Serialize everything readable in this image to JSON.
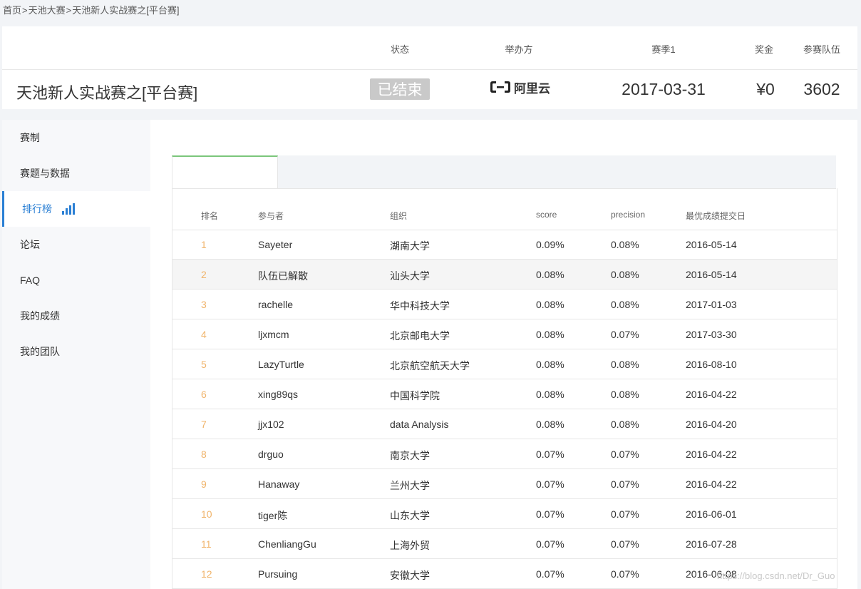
{
  "breadcrumb": [
    "首页",
    "天池大赛",
    "天池新人实战赛之[平台赛]"
  ],
  "breadcrumb_sep": ">",
  "header": {
    "labels": {
      "status": "状态",
      "organizer": "举办方",
      "season": "赛季1",
      "prize": "奖金",
      "teams": "参赛队伍"
    },
    "title": "天池新人实战赛之[平台赛]",
    "status": "已结束",
    "organizer_logo_text": "阿里云",
    "season_date": "2017-03-31",
    "prize": "¥0",
    "teams": "3602"
  },
  "sidebar": {
    "items": [
      {
        "label": "赛制"
      },
      {
        "label": "赛题与数据"
      },
      {
        "label": "排行榜",
        "active": true
      },
      {
        "label": "论坛"
      },
      {
        "label": "FAQ"
      },
      {
        "label": "我的成绩"
      },
      {
        "label": "我的团队"
      }
    ]
  },
  "table": {
    "columns": [
      "排名",
      "参与者",
      "组织",
      "score",
      "precision",
      "最优成绩提交日"
    ],
    "rows": [
      {
        "rank": "1",
        "name": "Sayeter",
        "org": "湖南大学",
        "score": "0.09%",
        "precision": "0.08%",
        "date": "2016-05-14"
      },
      {
        "rank": "2",
        "name": "队伍已解散",
        "org": "汕头大学",
        "score": "0.08%",
        "precision": "0.08%",
        "date": "2016-05-14"
      },
      {
        "rank": "3",
        "name": "rachelle",
        "org": "华中科技大学",
        "score": "0.08%",
        "precision": "0.08%",
        "date": "2017-01-03"
      },
      {
        "rank": "4",
        "name": "ljxmcm",
        "org": "北京邮电大学",
        "score": "0.08%",
        "precision": "0.07%",
        "date": "2017-03-30"
      },
      {
        "rank": "5",
        "name": "LazyTurtle",
        "org": "北京航空航天大学",
        "score": "0.08%",
        "precision": "0.08%",
        "date": "2016-08-10"
      },
      {
        "rank": "6",
        "name": "xing89qs",
        "org": "中国科学院",
        "score": "0.08%",
        "precision": "0.08%",
        "date": "2016-04-22"
      },
      {
        "rank": "7",
        "name": "jjx102",
        "org": "data Analysis",
        "score": "0.08%",
        "precision": "0.08%",
        "date": "2016-04-20"
      },
      {
        "rank": "8",
        "name": "drguo",
        "org": "南京大学",
        "score": "0.07%",
        "precision": "0.07%",
        "date": "2016-04-22"
      },
      {
        "rank": "9",
        "name": "Hanaway",
        "org": "兰州大学",
        "score": "0.07%",
        "precision": "0.07%",
        "date": "2016-04-22"
      },
      {
        "rank": "10",
        "name": "tiger陈",
        "org": "山东大学",
        "score": "0.07%",
        "precision": "0.07%",
        "date": "2016-06-01"
      },
      {
        "rank": "11",
        "name": "ChenliangGu",
        "org": "上海外贸",
        "score": "0.07%",
        "precision": "0.07%",
        "date": "2016-07-28"
      },
      {
        "rank": "12",
        "name": "Pursuing",
        "org": "安徽大学",
        "score": "0.07%",
        "precision": "0.07%",
        "date": "2016-06-08"
      }
    ]
  },
  "watermark": "https://blog.csdn.net/Dr_Guo",
  "colors": {
    "accent": "#2a7fd4",
    "rank": "#f0b46b",
    "status_badge": "#c9c9c9",
    "tab_top": "#7bc67b"
  }
}
